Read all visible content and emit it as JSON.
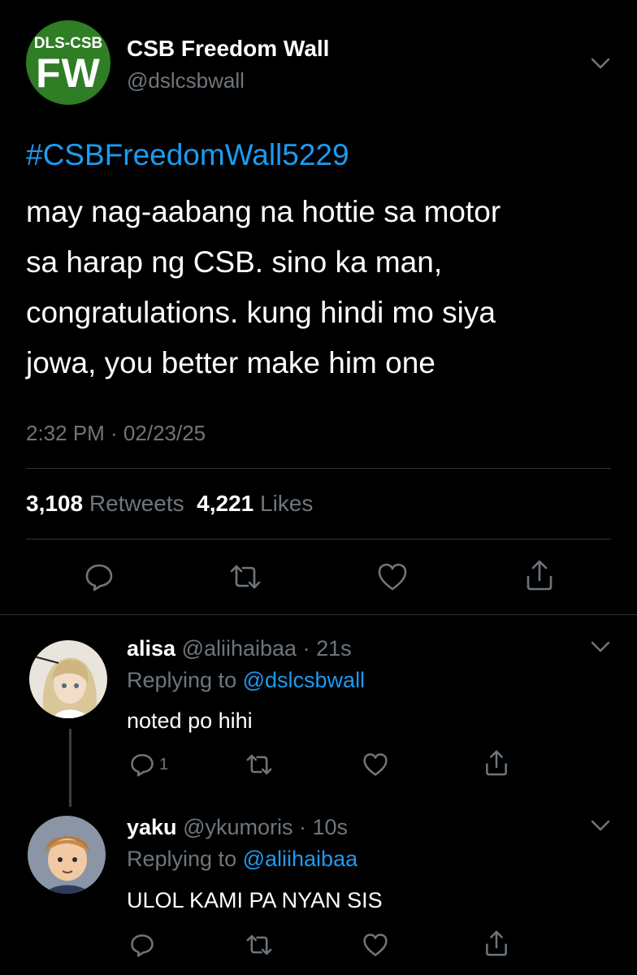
{
  "tweet": {
    "logo": {
      "line1": "DLS-CSB",
      "line2": "FW",
      "color": "#2f7d24"
    },
    "display_name": "CSB Freedom Wall",
    "handle": "@dslcsbwall",
    "hashtag": "#CSBFreedomWall5229",
    "body": "may nag-aabang na hottie sa motor\nsa harap ng CSB. sino ka man,\ncongratulations. kung hindi mo siya\njowa, you better make him one",
    "time": "2:32 PM · 02/23/25",
    "retweets_count": "3,108",
    "retweets_label": "Retweets",
    "likes_count": "4,221",
    "likes_label": "Likes"
  },
  "replies": [
    {
      "name": "alisa",
      "handle": "@aliihaibaa",
      "time": "· 21s",
      "replying_prefix": "Replying to",
      "replying_to": "@dslcsbwall",
      "text": "noted po hihi",
      "reply_count": "1"
    },
    {
      "name": "yaku",
      "handle": "@ykumoris",
      "time": "· 10s",
      "replying_prefix": "Replying to",
      "replying_to": "@aliihaibaa",
      "text": "ULOL KAMI PA NYAN SIS",
      "reply_count": ""
    }
  ],
  "colors": {
    "background": "#000000",
    "accent": "#1d9bf0",
    "muted": "#6e767d",
    "divider": "#2f3336"
  }
}
